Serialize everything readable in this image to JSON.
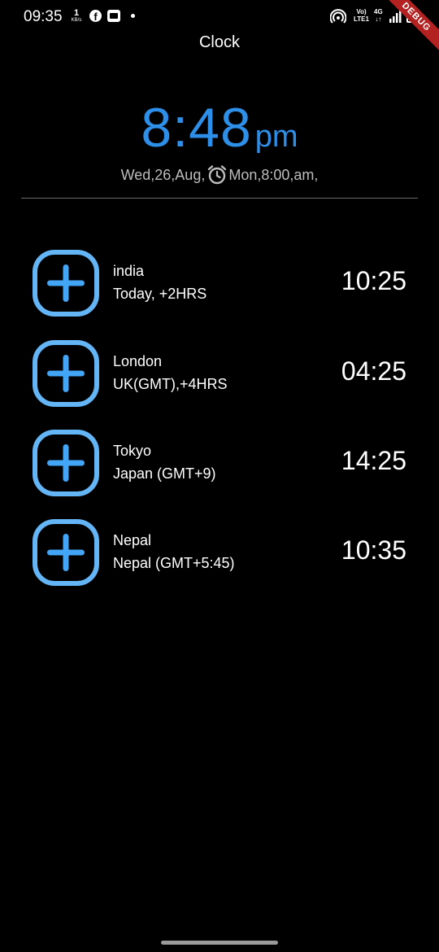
{
  "status_bar": {
    "time": "09:35",
    "speed_value": "1",
    "speed_unit": "KB/s",
    "volte_line1": "Vo)",
    "volte_line2": "LTE1",
    "network_line1": "4G",
    "network_line2": "↓↑",
    "debug_label": "DEBUG"
  },
  "app_bar": {
    "title": "Clock"
  },
  "clock": {
    "time": "8:48",
    "ampm": "pm",
    "date": "Wed,26,Aug,",
    "alarm": "Mon,8:00,am,"
  },
  "cities": [
    {
      "name": "india",
      "subtitle": "Today, +2HRS",
      "time": "10:25"
    },
    {
      "name": "London",
      "subtitle": "UK(GMT),+4HRS",
      "time": "04:25"
    },
    {
      "name": "Tokyo",
      "subtitle": "Japan (GMT+9)",
      "time": "14:25"
    },
    {
      "name": "Nepal",
      "subtitle": "Nepal (GMT+5:45)",
      "time": "10:35"
    }
  ],
  "icons": {
    "add": "add-box-icon",
    "alarm": "alarm-clock-icon"
  },
  "colors": {
    "accent": "#2e8fe8",
    "icon_outline": "#64b5f6",
    "icon_fill": "#42a5f5",
    "background": "#000000"
  }
}
